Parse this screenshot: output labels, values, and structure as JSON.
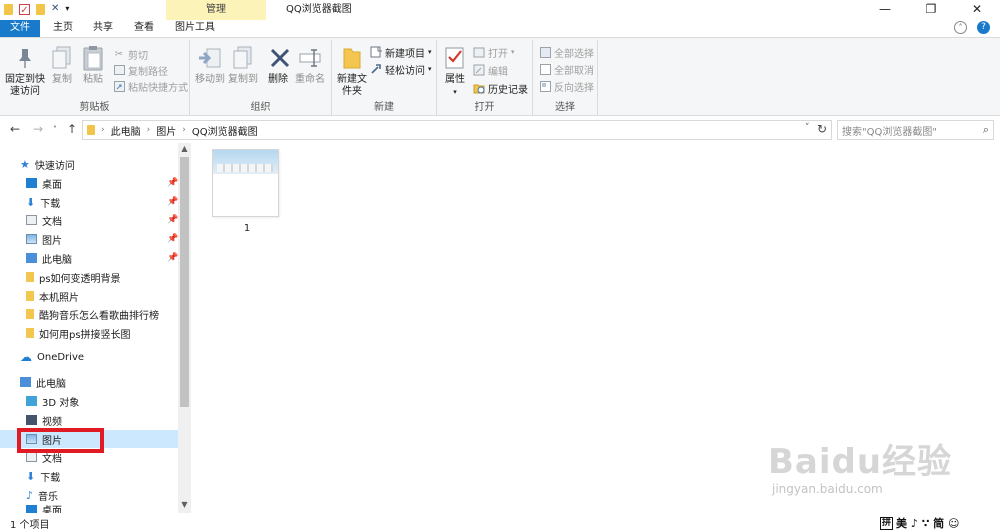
{
  "titlebar": {
    "manage_tab": "管理",
    "window_title": "QQ浏览器截图",
    "minimize": "—",
    "maximize": "❐",
    "close": "✕"
  },
  "tabs": {
    "file": "文件",
    "home": "主页",
    "share": "共享",
    "view": "查看",
    "picture_tools": "图片工具"
  },
  "ribbon": {
    "clipboard": {
      "label": "剪贴板",
      "pin": "固定到快速访问",
      "copy": "复制",
      "paste": "粘贴",
      "cut": "剪切",
      "copy_path": "复制路径",
      "paste_shortcut": "粘贴快捷方式"
    },
    "organize": {
      "label": "组织",
      "move_to": "移动到",
      "copy_to": "复制到",
      "delete": "删除",
      "rename": "重命名"
    },
    "new": {
      "label": "新建",
      "new_folder": "新建文件夹",
      "new_item": "新建项目",
      "easy_access": "轻松访问"
    },
    "open": {
      "label": "打开",
      "properties": "属性",
      "open": "打开",
      "edit": "编辑",
      "history": "历史记录"
    },
    "select": {
      "label": "选择",
      "select_all": "全部选择",
      "select_none": "全部取消",
      "invert": "反向选择"
    }
  },
  "address": {
    "crumbs": [
      "此电脑",
      "图片",
      "QQ浏览器截图"
    ],
    "search_placeholder": "搜索\"QQ浏览器截图\""
  },
  "nav": {
    "quick_access": "快速访问",
    "desktop": "桌面",
    "downloads": "下载",
    "documents": "文档",
    "pictures": "图片",
    "this_pc_pinned": "此电脑",
    "folder1": "ps如何变透明背景",
    "folder2": "本机照片",
    "folder3": "酷狗音乐怎么看歌曲排行榜",
    "folder4": "如何用ps拼接竖长图",
    "onedrive": "OneDrive",
    "this_pc": "此电脑",
    "objects3d": "3D 对象",
    "videos": "视频",
    "pc_pictures": "图片",
    "pc_documents": "文档",
    "pc_downloads": "下载",
    "music": "音乐",
    "pc_desktop": "桌面"
  },
  "files": [
    {
      "name": "1"
    }
  ],
  "status": {
    "item_count": "1 个项目"
  },
  "ime": {
    "label": "拼",
    "items": "美 ♪ ∵ 简 ☺"
  },
  "watermark": {
    "brand": "Baidu经验",
    "url": "jingyan.baidu.com"
  },
  "colors": {
    "accent": "#1979ca",
    "manage_tab": "#fcf3b8",
    "highlight": "#e01b24"
  }
}
